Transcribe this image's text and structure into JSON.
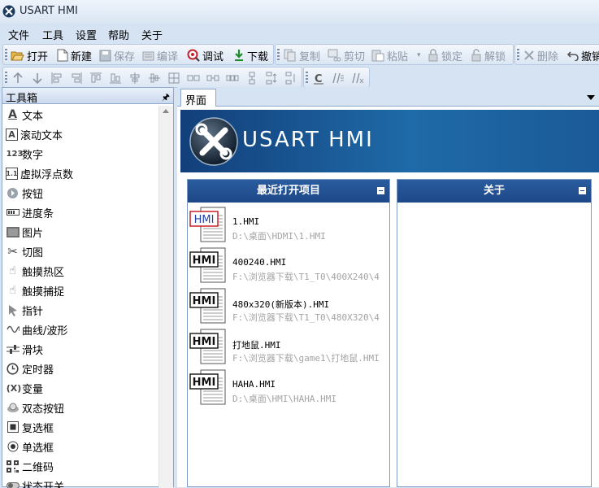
{
  "window": {
    "title": "USART HMI"
  },
  "menu": [
    "文件",
    "工具",
    "设置",
    "帮助",
    "关于"
  ],
  "toolbar": {
    "open": "打开",
    "new": "新建",
    "save": "保存",
    "compile": "编译",
    "debug": "调试",
    "download": "下载",
    "copy": "复制",
    "cut": "剪切",
    "paste": "粘贴",
    "lock": "锁定",
    "unlock": "解锁",
    "delete": "删除",
    "undo": "撤销"
  },
  "toolbox": {
    "title": "工具箱",
    "items": [
      {
        "label": "文本",
        "icon": "A"
      },
      {
        "label": "滚动文本",
        "icon": "A"
      },
      {
        "label": "数字",
        "icon": "123"
      },
      {
        "label": "虚拟浮点数",
        "icon": "1.1"
      },
      {
        "label": "按钮",
        "icon": "btn"
      },
      {
        "label": "进度条",
        "icon": "bar"
      },
      {
        "label": "图片",
        "icon": "img"
      },
      {
        "label": "切图",
        "icon": "cut"
      },
      {
        "label": "触摸热区",
        "icon": "hand"
      },
      {
        "label": "触摸捕捉",
        "icon": "hand"
      },
      {
        "label": "指针",
        "icon": "ptr"
      },
      {
        "label": "曲线/波形",
        "icon": "wave"
      },
      {
        "label": "滑块",
        "icon": "slider"
      },
      {
        "label": "定时器",
        "icon": "clock"
      },
      {
        "label": "变量",
        "icon": "(X)"
      },
      {
        "label": "双态按钮",
        "icon": "dual"
      },
      {
        "label": "复选框",
        "icon": "chk"
      },
      {
        "label": "单选框",
        "icon": "radio"
      },
      {
        "label": "二维码",
        "icon": "qr"
      },
      {
        "label": "状态开关",
        "icon": "sw"
      }
    ]
  },
  "tabs": {
    "active": "界面"
  },
  "banner": {
    "title": "USART HMI"
  },
  "recent_panel": {
    "title": "最近打开项目",
    "icon_label": "HMI",
    "items": [
      {
        "name": "1.HMI",
        "path": "D:\\桌面\\HDMI\\1.HMI"
      },
      {
        "name": "400240.HMI",
        "path": "F:\\浏览器下载\\T1_T0\\400X240\\4"
      },
      {
        "name": "480x320(新版本).HMI",
        "path": "F:\\浏览器下载\\T1_T0\\480X320\\4"
      },
      {
        "name": "打地鼠.HMI",
        "path": "F:\\浏览器下载\\game1\\打地鼠.HMI"
      },
      {
        "name": "HAHA.HMI",
        "path": "D:\\桌面\\HMI\\HAHA.HMI"
      }
    ]
  },
  "about_panel": {
    "title": "关于"
  }
}
